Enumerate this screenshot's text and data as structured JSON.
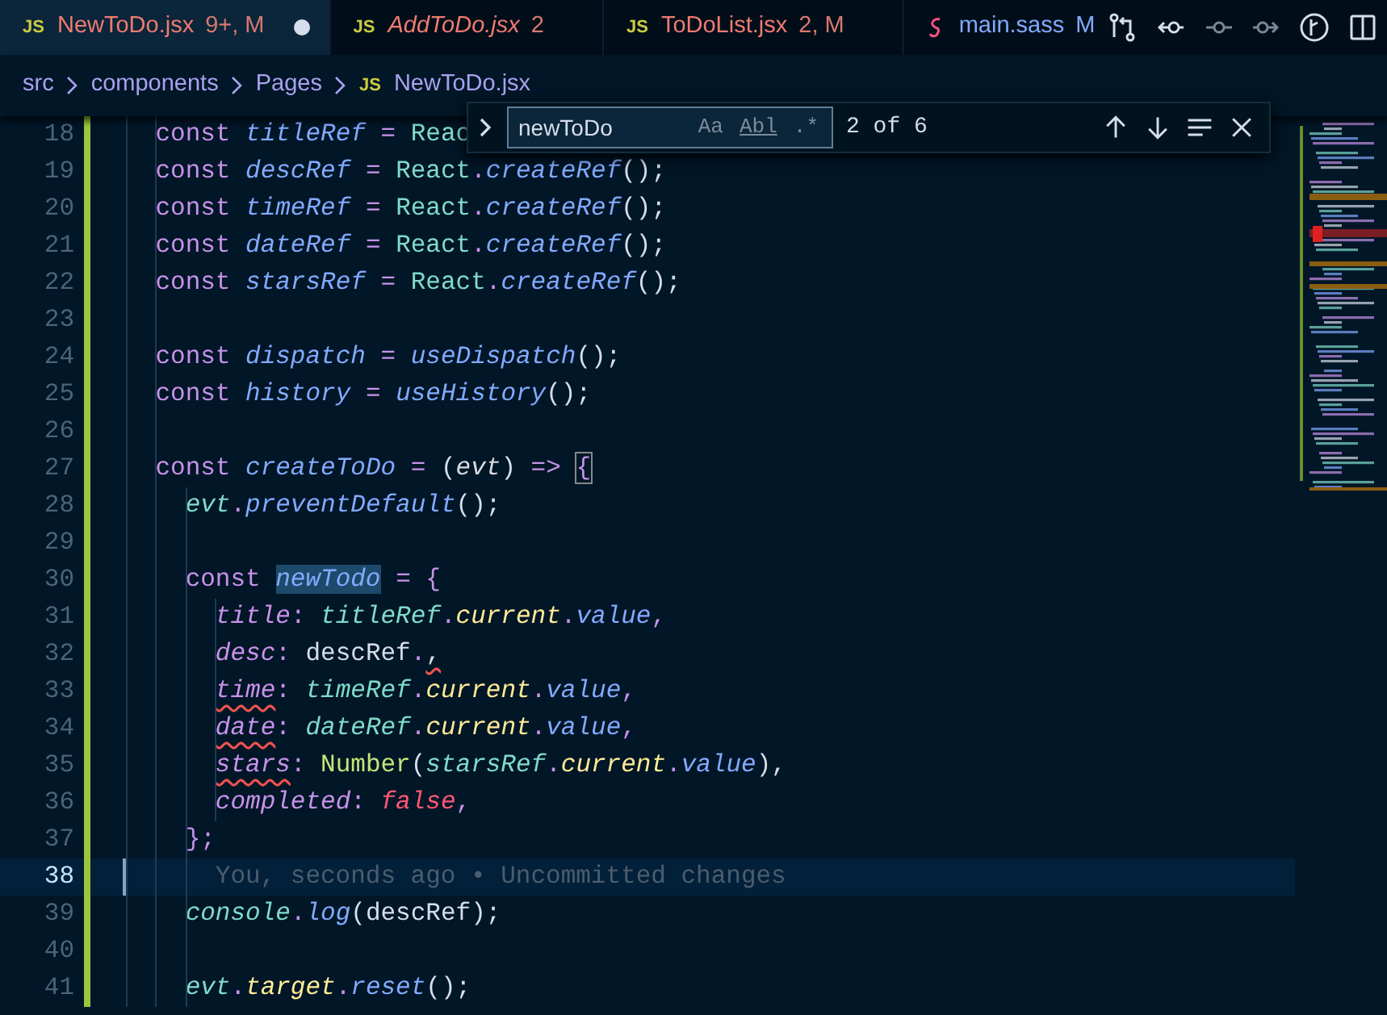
{
  "tabs": [
    {
      "kind": "js",
      "icon": "JS",
      "label": "NewToDo.jsx",
      "status": "9+, M",
      "selected": true,
      "dirty": true
    },
    {
      "kind": "js",
      "icon": "JS",
      "label": "AddToDo.jsx",
      "status": "2",
      "selected": false,
      "preview": true
    },
    {
      "kind": "js",
      "icon": "JS",
      "label": "ToDoList.jsx",
      "status": "2, M",
      "selected": false
    },
    {
      "kind": "sass",
      "label": "main.sass",
      "status": "M",
      "selected": false
    }
  ],
  "breadcrumbs": [
    {
      "kind": "folder",
      "label": "src"
    },
    {
      "kind": "folder",
      "label": "components"
    },
    {
      "kind": "folder",
      "label": "Pages"
    },
    {
      "kind": "js",
      "icon": "JS",
      "label": "NewToDo.jsx"
    }
  ],
  "find_widget": {
    "value": "newToDo",
    "options": [
      {
        "label": "Aa",
        "on": false
      },
      {
        "label": "Abl",
        "on": false
      },
      {
        "label": ".*",
        "on": false
      }
    ],
    "result": "2 of 6"
  },
  "lines": [
    {
      "number": "18",
      "tokens": [
        {
          "text": "    const ",
          "kind": "keyword"
        },
        {
          "text": "titleRef",
          "kind": "var"
        },
        {
          "text": " = ",
          "kind": "op"
        },
        {
          "text": "Reac",
          "kind": "class"
        }
      ]
    },
    {
      "number": "19",
      "tokens": [
        {
          "text": "    const ",
          "kind": "keyword"
        },
        {
          "text": "descRef",
          "kind": "var"
        },
        {
          "text": " = ",
          "kind": "op"
        },
        {
          "text": "React",
          "kind": "class"
        },
        {
          "text": ".",
          "kind": "op"
        },
        {
          "text": "createRef",
          "kind": "method"
        },
        {
          "text": "();",
          "kind": "punct"
        }
      ]
    },
    {
      "number": "20",
      "tokens": [
        {
          "text": "    const ",
          "kind": "keyword"
        },
        {
          "text": "timeRef",
          "kind": "var"
        },
        {
          "text": " = ",
          "kind": "op"
        },
        {
          "text": "React",
          "kind": "class"
        },
        {
          "text": ".",
          "kind": "op"
        },
        {
          "text": "createRef",
          "kind": "method"
        },
        {
          "text": "();",
          "kind": "punct"
        }
      ]
    },
    {
      "number": "21",
      "tokens": [
        {
          "text": "    const ",
          "kind": "keyword"
        },
        {
          "text": "dateRef",
          "kind": "var"
        },
        {
          "text": " = ",
          "kind": "op"
        },
        {
          "text": "React",
          "kind": "class"
        },
        {
          "text": ".",
          "kind": "op"
        },
        {
          "text": "createRef",
          "kind": "method"
        },
        {
          "text": "();",
          "kind": "punct"
        }
      ]
    },
    {
      "number": "22",
      "tokens": [
        {
          "text": "    const ",
          "kind": "keyword"
        },
        {
          "text": "starsRef",
          "kind": "var"
        },
        {
          "text": " = ",
          "kind": "op"
        },
        {
          "text": "React",
          "kind": "class"
        },
        {
          "text": ".",
          "kind": "op"
        },
        {
          "text": "createRef",
          "kind": "method"
        },
        {
          "text": "();",
          "kind": "punct"
        }
      ]
    },
    {
      "number": "23"
    },
    {
      "number": "24",
      "tokens": [
        {
          "text": "    const ",
          "kind": "keyword"
        },
        {
          "text": "dispatch",
          "kind": "var"
        },
        {
          "text": " = ",
          "kind": "op"
        },
        {
          "text": "useDispatch",
          "kind": "method"
        },
        {
          "text": "();",
          "kind": "punct"
        }
      ]
    },
    {
      "number": "25",
      "tokens": [
        {
          "text": "    const ",
          "kind": "keyword"
        },
        {
          "text": "history",
          "kind": "var"
        },
        {
          "text": " = ",
          "kind": "op"
        },
        {
          "text": "useHistory",
          "kind": "method"
        },
        {
          "text": "();",
          "kind": "punct"
        }
      ]
    },
    {
      "number": "26"
    },
    {
      "number": "27",
      "tokens": [
        {
          "text": "    const ",
          "kind": "keyword"
        },
        {
          "text": "createToDo",
          "kind": "var"
        },
        {
          "text": " = ",
          "kind": "op"
        },
        {
          "text": "(",
          "kind": "punct"
        },
        {
          "text": "evt",
          "kind": "param"
        },
        {
          "text": ") ",
          "kind": "punct"
        },
        {
          "text": "=> ",
          "kind": "op"
        },
        {
          "text": "{",
          "kind": "bracket"
        }
      ]
    },
    {
      "number": "28",
      "tokens": [
        {
          "text": "      evt",
          "kind": "object"
        },
        {
          "text": ".",
          "kind": "op"
        },
        {
          "text": "preventDefault",
          "kind": "method"
        },
        {
          "text": "();",
          "kind": "punct"
        }
      ]
    },
    {
      "number": "29"
    },
    {
      "number": "30",
      "tokens": [
        {
          "text": "      const ",
          "kind": "keyword"
        },
        {
          "text": "newTodo",
          "kind": "match"
        },
        {
          "text": " = ",
          "kind": "op"
        },
        {
          "text": "{",
          "kind": "op"
        }
      ]
    },
    {
      "number": "31",
      "tokens": [
        {
          "text": "        title",
          "kind": "prop"
        },
        {
          "text": ": ",
          "kind": "op"
        },
        {
          "text": "titleRef",
          "kind": "object"
        },
        {
          "text": ".",
          "kind": "op"
        },
        {
          "text": "current",
          "kind": "member"
        },
        {
          "text": ".",
          "kind": "op"
        },
        {
          "text": "value",
          "kind": "method"
        },
        {
          "text": ",",
          "kind": "op"
        }
      ]
    },
    {
      "number": "32",
      "tokens": [
        {
          "text": "        desc",
          "kind": "prop"
        },
        {
          "text": ": ",
          "kind": "op"
        },
        {
          "text": "descRef",
          "kind": "plain"
        },
        {
          "text": ".",
          "kind": "op"
        },
        {
          "text": ",",
          "kind": "error"
        }
      ]
    },
    {
      "number": "33",
      "tokens": [
        {
          "text": "        time",
          "kind": "error-prop"
        },
        {
          "text": ": ",
          "kind": "op"
        },
        {
          "text": "timeRef",
          "kind": "object"
        },
        {
          "text": ".",
          "kind": "op"
        },
        {
          "text": "current",
          "kind": "member"
        },
        {
          "text": ".",
          "kind": "op"
        },
        {
          "text": "value",
          "kind": "method"
        },
        {
          "text": ",",
          "kind": "op"
        }
      ]
    },
    {
      "number": "34",
      "tokens": [
        {
          "text": "        date",
          "kind": "error-prop"
        },
        {
          "text": ": ",
          "kind": "op"
        },
        {
          "text": "dateRef",
          "kind": "object"
        },
        {
          "text": ".",
          "kind": "op"
        },
        {
          "text": "current",
          "kind": "member"
        },
        {
          "text": ".",
          "kind": "op"
        },
        {
          "text": "value",
          "kind": "method"
        },
        {
          "text": ",",
          "kind": "op"
        }
      ]
    },
    {
      "number": "35",
      "tokens": [
        {
          "text": "        stars",
          "kind": "error-prop"
        },
        {
          "text": ": ",
          "kind": "op"
        },
        {
          "text": "Number",
          "kind": "builtin"
        },
        {
          "text": "(",
          "kind": "punct"
        },
        {
          "text": "starsRef",
          "kind": "object"
        },
        {
          "text": ".",
          "kind": "op"
        },
        {
          "text": "current",
          "kind": "member"
        },
        {
          "text": ".",
          "kind": "op"
        },
        {
          "text": "value",
          "kind": "method"
        },
        {
          "text": "),",
          "kind": "punct"
        }
      ]
    },
    {
      "number": "36",
      "tokens": [
        {
          "text": "        completed",
          "kind": "prop"
        },
        {
          "text": ": ",
          "kind": "op"
        },
        {
          "text": "false",
          "kind": "bool"
        },
        {
          "text": ",",
          "kind": "op"
        }
      ]
    },
    {
      "number": "37",
      "tokens": [
        {
          "text": "      };",
          "kind": "op"
        }
      ]
    },
    {
      "number": "38",
      "current": true,
      "blame": "You, seconds ago • Uncommitted changes"
    },
    {
      "number": "39",
      "tokens": [
        {
          "text": "      console",
          "kind": "object"
        },
        {
          "text": ".",
          "kind": "op"
        },
        {
          "text": "log",
          "kind": "method"
        },
        {
          "text": "(descRef);",
          "kind": "punct"
        }
      ]
    },
    {
      "number": "40"
    },
    {
      "number": "41",
      "tokens": [
        {
          "text": "      evt",
          "kind": "object"
        },
        {
          "text": ".",
          "kind": "op"
        },
        {
          "text": "target",
          "kind": "member"
        },
        {
          "text": ".",
          "kind": "op"
        },
        {
          "text": "reset",
          "kind": "method"
        },
        {
          "text": "();",
          "kind": "punct"
        }
      ]
    }
  ]
}
